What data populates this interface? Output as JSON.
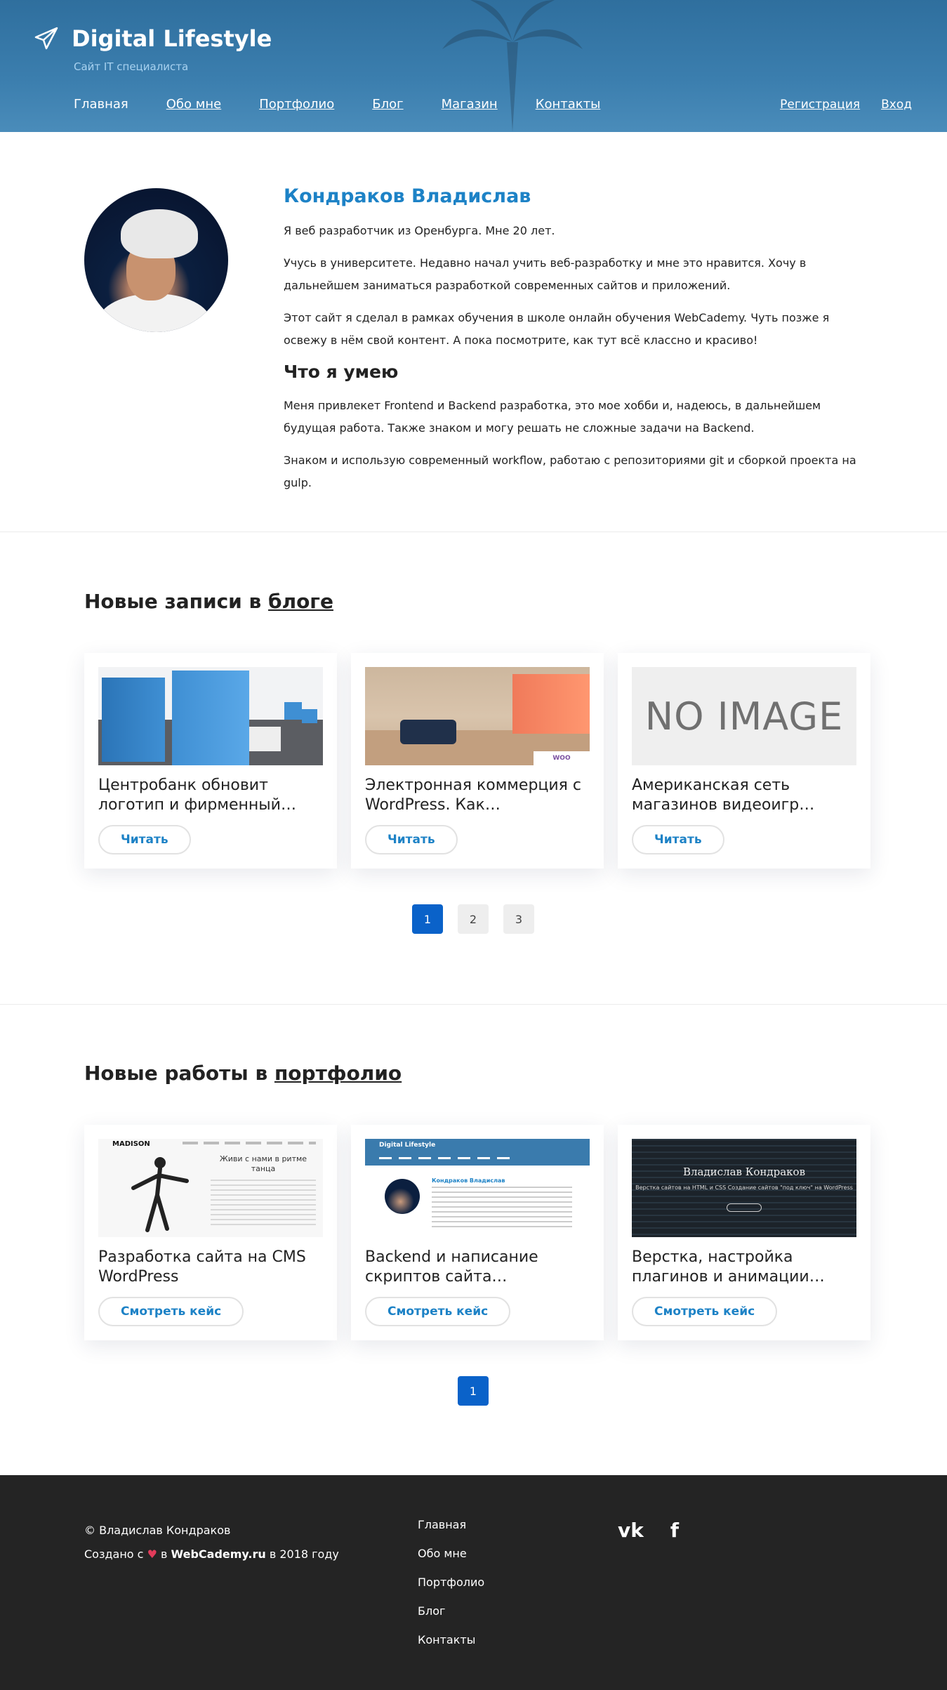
{
  "header": {
    "brand_title": "Digital Lifestyle",
    "tagline": "Сайт IT специалиста",
    "nav": [
      "Главная",
      "Обо мне",
      "Портфолио",
      "Блог",
      "Магазин",
      "Контакты"
    ],
    "auth": {
      "register": "Регистрация",
      "login": "Вход"
    },
    "logo_icon": "paper-plane-icon"
  },
  "about": {
    "name": "Кондраков Владислав",
    "p1": "Я веб разработчик из Оренбурга. Мне 20 лет.",
    "p2": "Учусь в университете. Недавно начал учить веб-разработку и мне это нравится. Хочу в дальнейшем заниматься разработкой современных сайтов и приложений.",
    "p3": "Этот сайт я сделал в рамках обучения в школе онлайн обучения WebCademy. Чуть позже я освежу в нём свой контент. А пока посмотрите, как тут всё классно и красиво!",
    "skills_title": "Что я умею",
    "p4": "Меня привлекет Frontend и Backend разработка, это мое хобби и, надеюсь, в дальнейшем будущая работа. Также знаком и могу решать не сложные задачи на Backend.",
    "p5": "Знаком и использую современный workflow, работаю с репозиториями git и сборкой проекта на gulp."
  },
  "blog": {
    "title_prefix": "Новые записи в ",
    "title_link": "блоге",
    "cards": [
      {
        "title": "Центробанк обновит логотип и фирменный…",
        "button": "Читать"
      },
      {
        "title": "Электронная коммерция с WordPress. Как…",
        "button": "Читать"
      },
      {
        "title": "Американская сеть магазинов видеоигр…",
        "button": "Читать",
        "thumb_text": "NO IMAGE"
      }
    ],
    "pages": [
      "1",
      "2",
      "3"
    ],
    "active_page": "1",
    "thumb_extra": {
      "woo": "WOO COMMERCE"
    }
  },
  "portfolio": {
    "title_prefix": "Новые работы в ",
    "title_link": "портфолио",
    "cards": [
      {
        "title": "Разработка сайта на CMS WordPress",
        "button": "Смотреть кейс"
      },
      {
        "title": "Backend и написание скриптов сайта…",
        "button": "Смотреть кейс"
      },
      {
        "title": "Верстка, настройка плагинов и анимации…",
        "button": "Смотреть кейс"
      }
    ],
    "pages": [
      "1"
    ],
    "active_page": "1",
    "thumb_text": {
      "madison_logo": "MADISON",
      "madison_slogan": "Живи с нами в ритме танца",
      "site_brand": "Digital Lifestyle",
      "site_name": "Кондраков Владислав",
      "dark_name": "Владислав Кондраков",
      "dark_sub": "Верстка сайтов на HTML и CSS Создание сайтов \"под ключ\" на WordPress"
    }
  },
  "footer": {
    "copyright": "© Владислав Кондраков",
    "created_prefix": "Создано с ",
    "created_mid": " в ",
    "created_brand": "WebCademy.ru",
    "created_suffix": " в 2018 году",
    "nav": [
      "Главная",
      "Обо мне",
      "Портфолио",
      "Блог",
      "Контакты"
    ],
    "social": {
      "vk": "vk",
      "facebook": "f"
    }
  },
  "colors": {
    "accent": "#1d82c6",
    "pager_active": "#0a62c9",
    "footer_bg": "#242424"
  }
}
